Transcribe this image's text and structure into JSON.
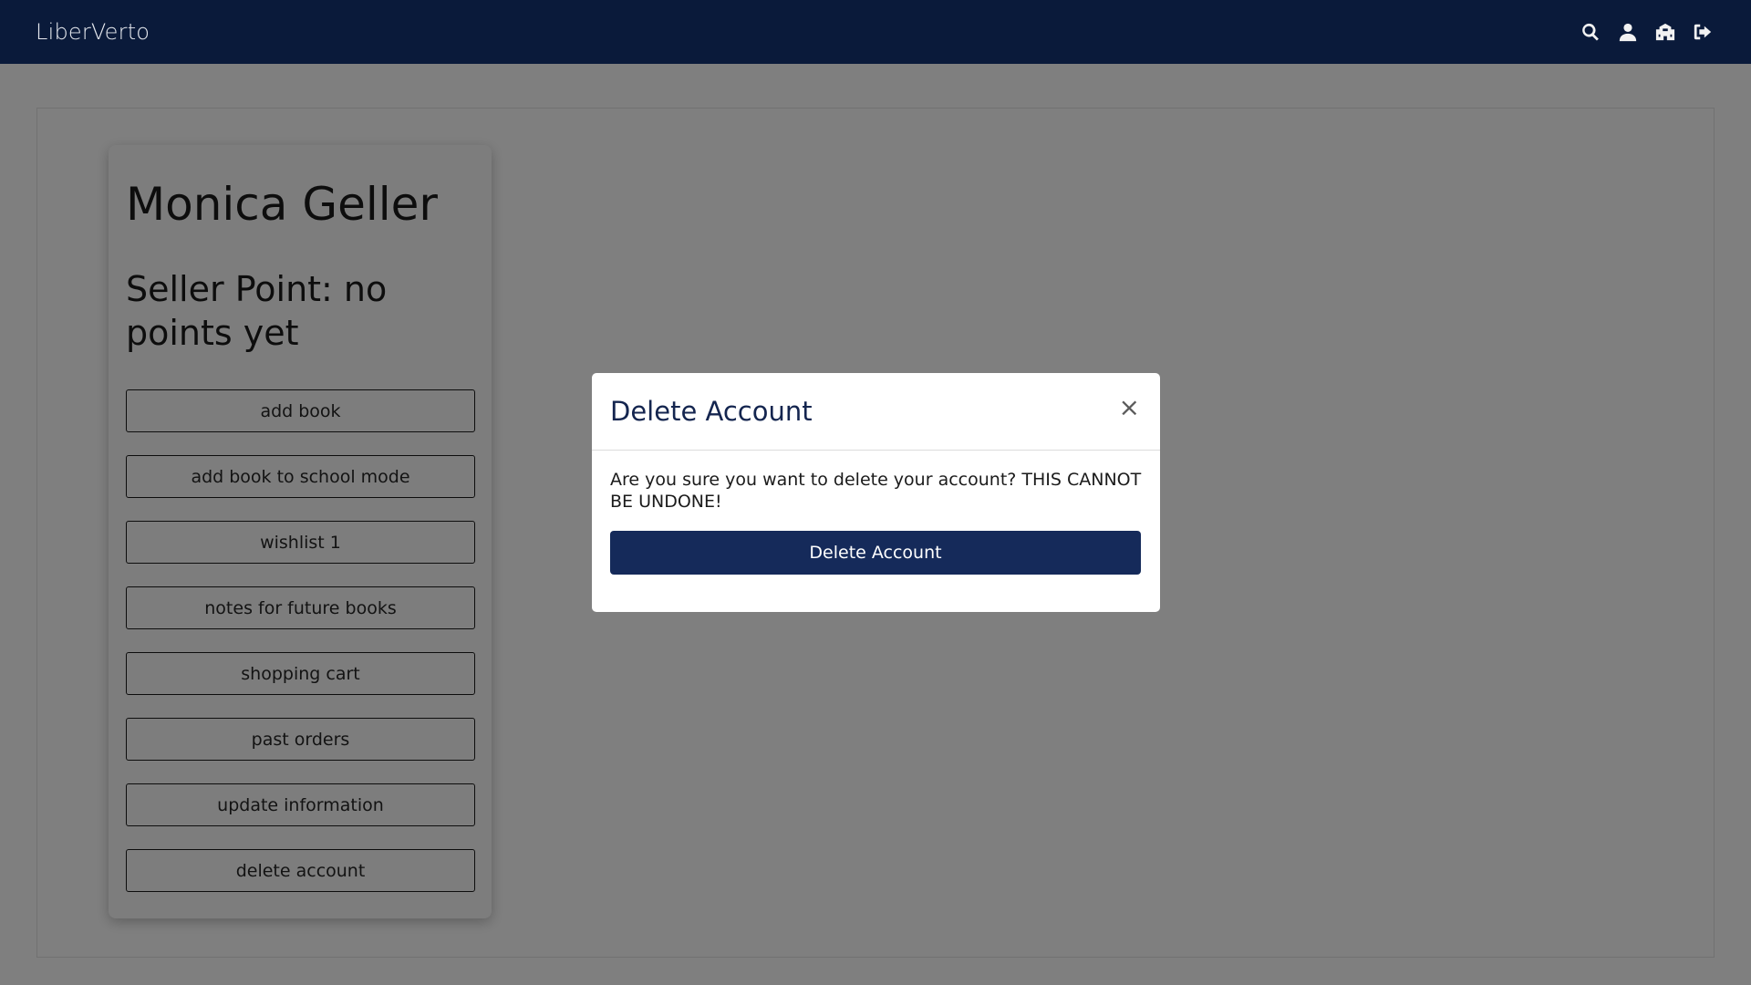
{
  "navbar": {
    "brand": "LiberVerto",
    "icons": [
      "search-icon",
      "user-icon",
      "school-icon",
      "sign-out-icon"
    ]
  },
  "profile": {
    "name": "Monica Geller",
    "seller_point": "Seller Point: no points yet",
    "menu": [
      {
        "label": "add book"
      },
      {
        "label": "add book to school mode"
      },
      {
        "label": "wishlist 1"
      },
      {
        "label": "notes for future books"
      },
      {
        "label": "shopping cart"
      },
      {
        "label": "past orders"
      },
      {
        "label": "update information"
      },
      {
        "label": "delete account"
      }
    ]
  },
  "modal": {
    "title": "Delete Account",
    "close": "×",
    "message": "Are you sure you want to delete your account? THIS CANNOT BE UNDONE!",
    "confirm_label": "Delete Account"
  },
  "colors": {
    "navbar": "#0a1a3a",
    "primary_button": "#152a5a",
    "modal_title": "#14254f"
  }
}
